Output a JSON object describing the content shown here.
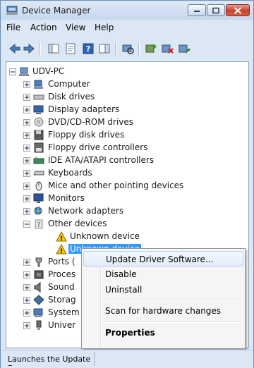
{
  "window": {
    "title": "Device Manager"
  },
  "menu": [
    "File",
    "Action",
    "View",
    "Help"
  ],
  "toolbar_icons": [
    "back-icon",
    "forward-icon",
    "console-tree-icon",
    "properties-icon",
    "help-icon",
    "show-hide-icon",
    "scan-hardware-icon",
    "update-driver-icon",
    "disable-device-icon",
    "uninstall-device-icon"
  ],
  "tree": {
    "root": "UDV-PC",
    "categories": [
      "Computer",
      "Disk drives",
      "Display adapters",
      "DVD/CD-ROM drives",
      "Floppy disk drives",
      "Floppy drive controllers",
      "IDE ATA/ATAPI controllers",
      "Keyboards",
      "Mice and other pointing devices",
      "Monitors",
      "Network adapters",
      "Other devices"
    ],
    "other_devices": [
      "Unknown device",
      "Unknown device"
    ],
    "after": [
      "Ports (",
      "Proces",
      "Sound",
      "Storag",
      "System",
      "Univer"
    ]
  },
  "context_menu": {
    "items": [
      "Update Driver Software...",
      "Disable",
      "Uninstall",
      "Scan for hardware changes",
      "Properties"
    ]
  },
  "status": {
    "text": "Launches the Update D"
  },
  "colors": {
    "selection": "#3399ff",
    "window_bg": "#dbe7f4"
  }
}
